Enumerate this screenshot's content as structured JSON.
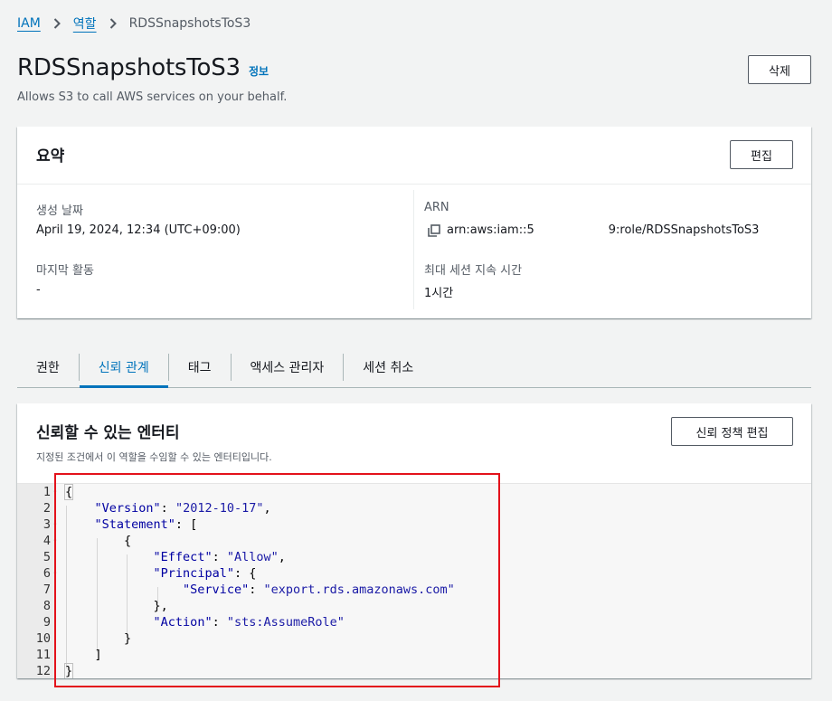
{
  "breadcrumb": {
    "items": [
      {
        "label": "IAM"
      },
      {
        "label": "역할"
      }
    ],
    "current": "RDSSnapshotsToS3"
  },
  "header": {
    "title": "RDSSnapshotsToS3",
    "info_label": "정보",
    "description": "Allows S3 to call AWS services on your behalf.",
    "delete_label": "삭제"
  },
  "summary": {
    "title": "요약",
    "edit_label": "편집",
    "created_label": "생성 날짜",
    "created_value": "April 19, 2024, 12:34 (UTC+09:00)",
    "last_activity_label": "마지막 활동",
    "last_activity_value": "-",
    "arn_label": "ARN",
    "arn_prefix": "arn:aws:iam::5",
    "arn_suffix": "9:role/RDSSnapshotsToS3",
    "max_session_label": "최대 세션 지속 시간",
    "max_session_value": "1시간"
  },
  "tabs": [
    {
      "label": "권한"
    },
    {
      "label": "신뢰 관계",
      "active": true
    },
    {
      "label": "태그"
    },
    {
      "label": "액세스 관리자"
    },
    {
      "label": "세션 취소"
    }
  ],
  "trust": {
    "title": "신뢰할 수 있는 엔터티",
    "description": "지정된 조건에서 이 역할을 수임할 수 있는 엔터티입니다.",
    "edit_label": "신뢰 정책 편집"
  },
  "policy": {
    "line_numbers": [
      "1",
      "2",
      "3",
      "4",
      "5",
      "6",
      "7",
      "8",
      "9",
      "10",
      "11",
      "12"
    ],
    "open_brace": "{",
    "close_brace": "}",
    "version_key": "\"Version\"",
    "version_value": "\"2012-10-17\"",
    "statement_key": "\"Statement\"",
    "effect_key": "\"Effect\"",
    "effect_value": "\"Allow\"",
    "principal_key": "\"Principal\"",
    "service_key": "\"Service\"",
    "service_value": "\"export.rds.amazonaws.com\"",
    "action_key": "\"Action\"",
    "action_value": "\"sts:AssumeRole\""
  },
  "colors": {
    "link": "#0073bb",
    "highlight": "#e3121b"
  }
}
